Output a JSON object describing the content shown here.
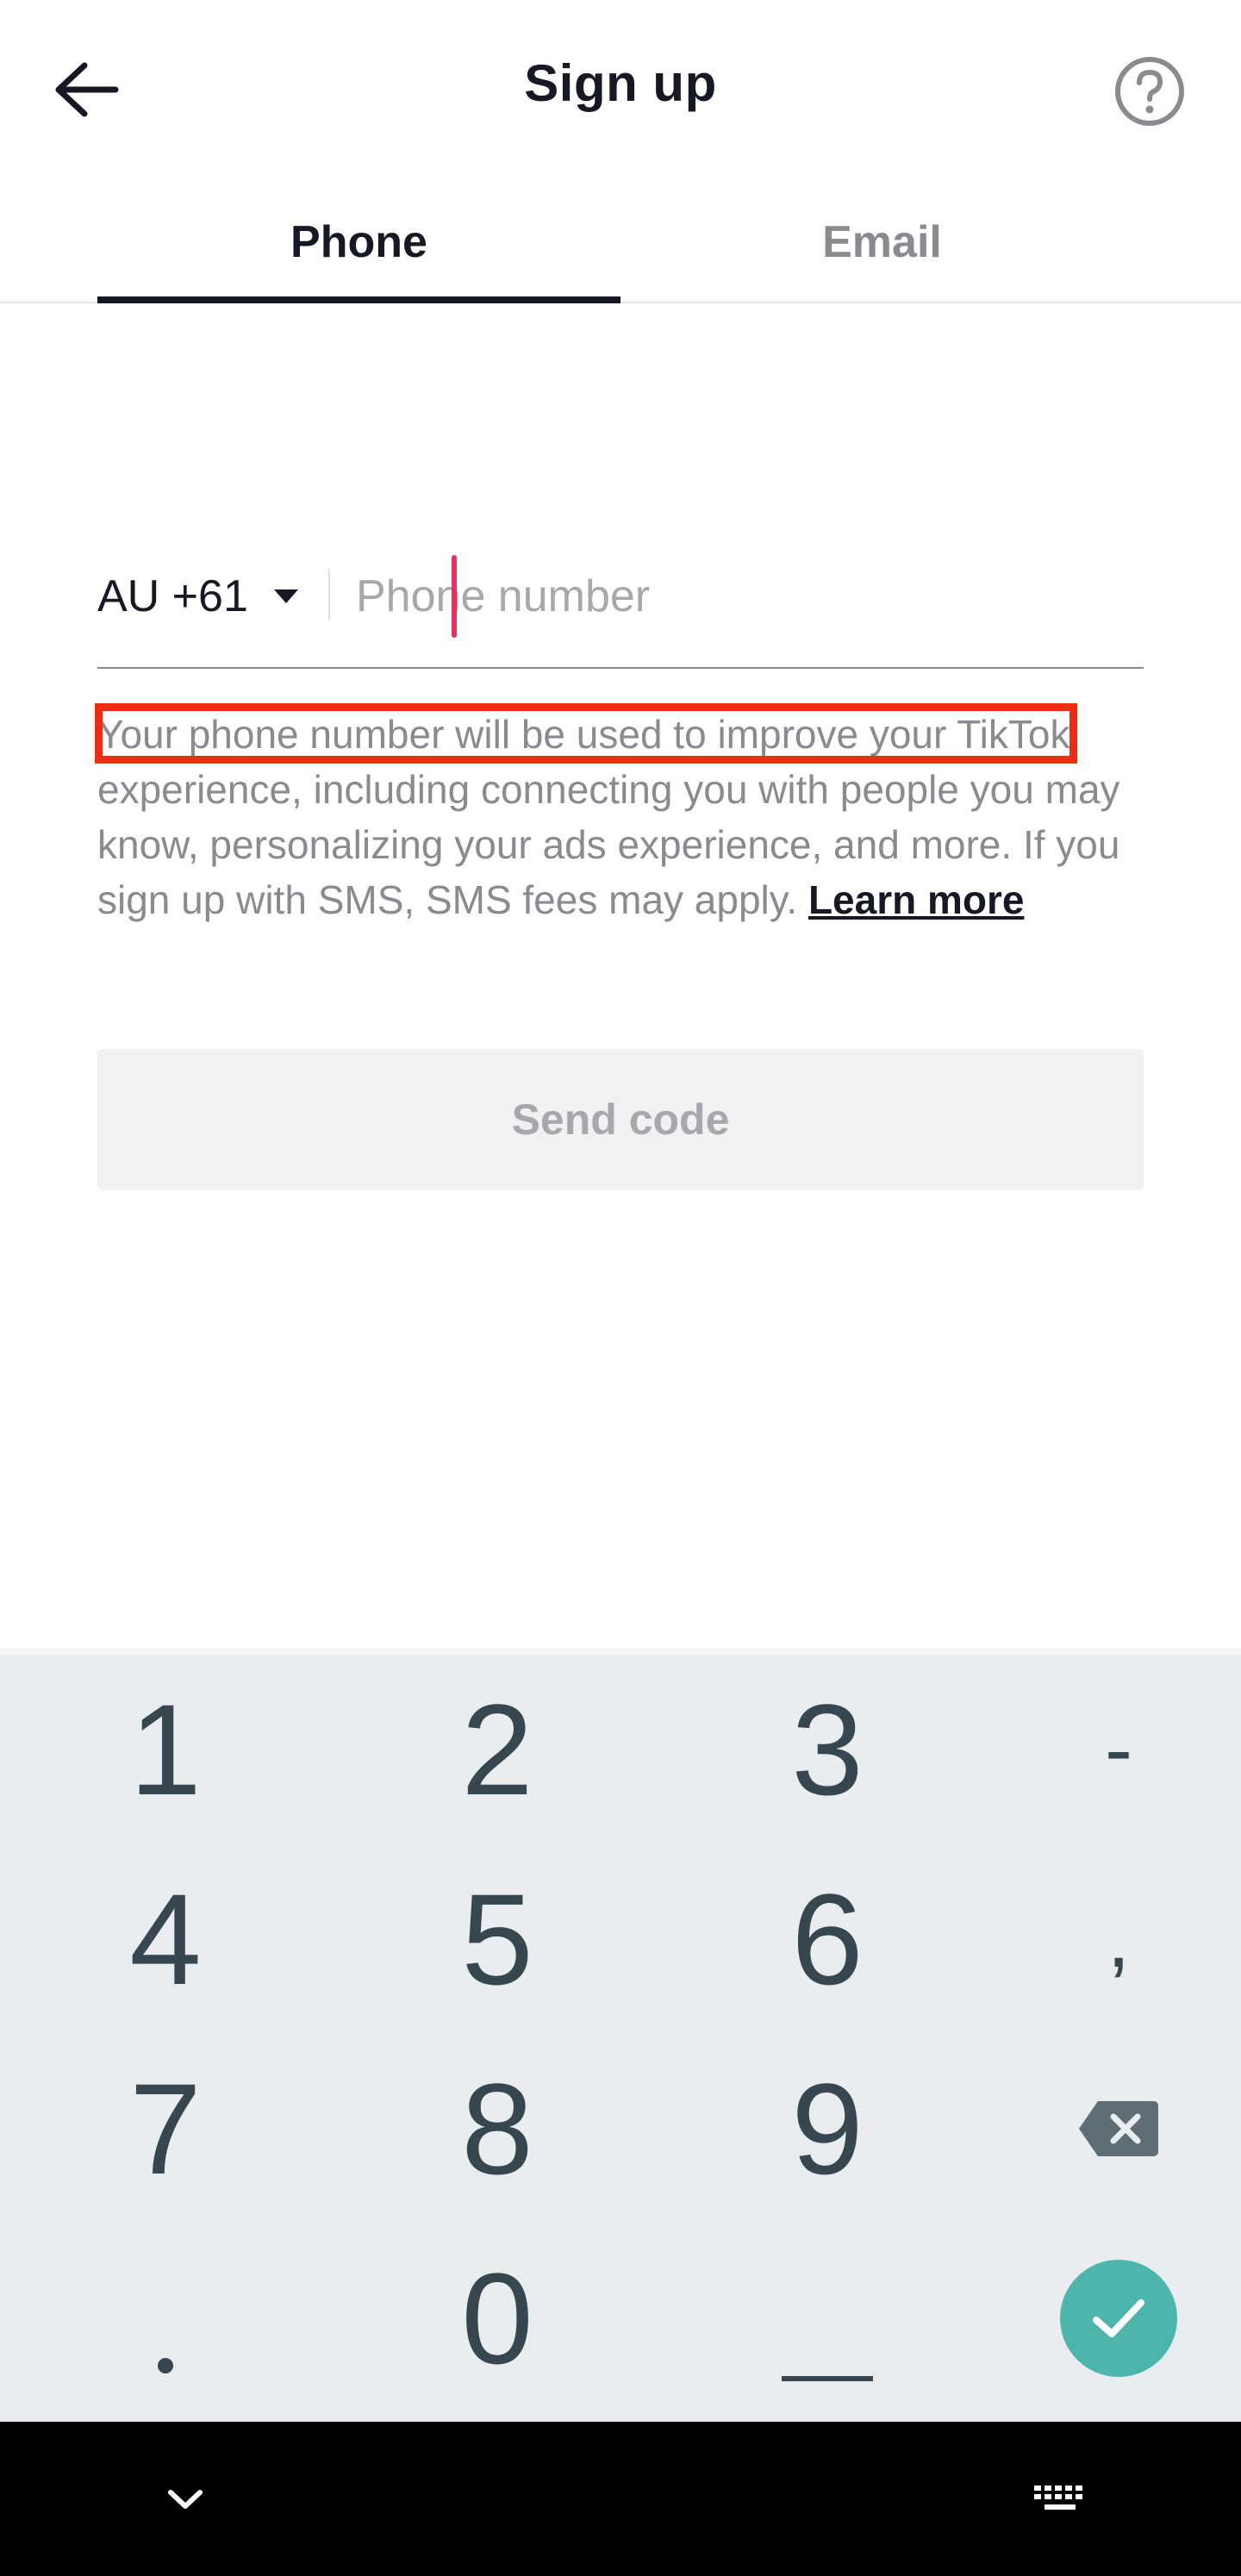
{
  "header": {
    "title": "Sign up",
    "back_icon": "arrow-left-icon",
    "help_icon": "question-circle-icon"
  },
  "tabs": [
    {
      "label": "Phone",
      "active": true
    },
    {
      "label": "Email",
      "active": false
    }
  ],
  "phone_form": {
    "country_code": "AU +61",
    "phone_placeholder": "Phone number",
    "phone_value": ""
  },
  "info": {
    "text": "Your phone number will be used to improve your TikTok experience, including connecting you with people you may know, personalizing your ads experience, and more. If you sign up with SMS, SMS fees may apply.",
    "learn_more": "Learn more"
  },
  "send_button": {
    "label": "Send code",
    "enabled": false
  },
  "keyboard": {
    "row1": [
      "1",
      "2",
      "3",
      "-"
    ],
    "row2": [
      "4",
      "5",
      "6",
      ","
    ],
    "row3": [
      "7",
      "8",
      "9"
    ],
    "row4_zero": "0"
  },
  "colors": {
    "accent": "#e8315a",
    "highlight": "#f02d12",
    "keyboard_bg": "#eaedf0",
    "done_key": "#4db6ac"
  }
}
